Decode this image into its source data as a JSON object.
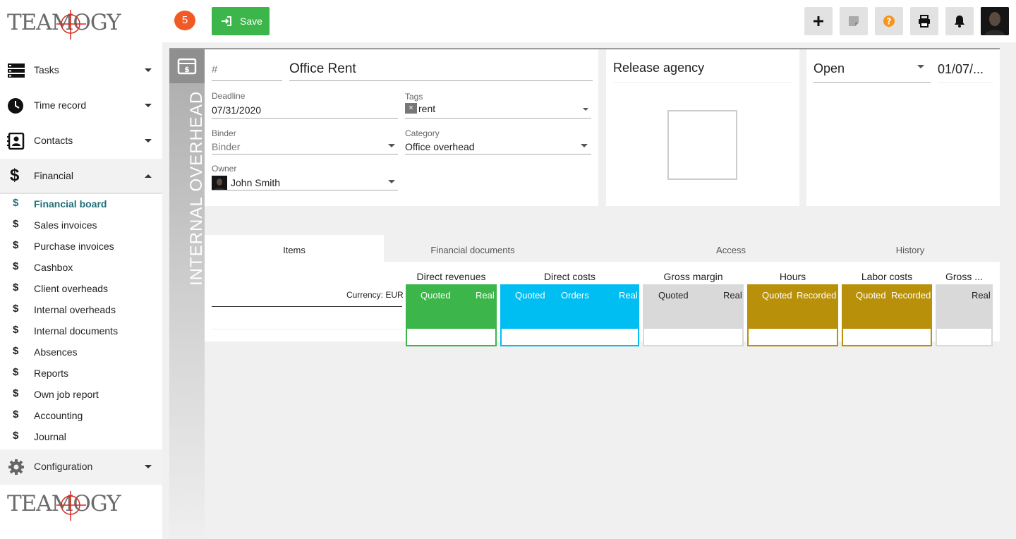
{
  "brand": {
    "logo_text": "TEAMOGY"
  },
  "sidebar": {
    "items": [
      {
        "label": "Tasks"
      },
      {
        "label": "Time record"
      },
      {
        "label": "Contacts"
      },
      {
        "label": "Financial"
      }
    ],
    "financial_sub": [
      {
        "label": "Financial board"
      },
      {
        "label": "Sales invoices"
      },
      {
        "label": "Purchase invoices"
      },
      {
        "label": "Cashbox"
      },
      {
        "label": "Client overheads"
      },
      {
        "label": "Internal overheads"
      },
      {
        "label": "Internal documents"
      },
      {
        "label": "Absences"
      },
      {
        "label": "Reports"
      },
      {
        "label": "Own job report"
      },
      {
        "label": "Accounting"
      },
      {
        "label": "Journal"
      }
    ],
    "config_label": "Configuration"
  },
  "toolbar": {
    "notification_count": "5",
    "save_label": "Save"
  },
  "record": {
    "type_label": "INTERNAL OVERHEAD",
    "number_placeholder": "#",
    "title": "Office Rent",
    "deadline_label": "Deadline",
    "deadline": "07/31/2020",
    "tags_label": "Tags",
    "tag": "rent",
    "tag_remove": "×",
    "binder_label": "Binder",
    "binder_placeholder": "Binder",
    "category_label": "Category",
    "category": "Office overhead",
    "owner_label": "Owner",
    "owner": "John Smith",
    "agency_title": "Release agency",
    "status": "Open",
    "date": "01/07/..."
  },
  "tabs": [
    {
      "label": "Items"
    },
    {
      "label": "Financial documents"
    },
    {
      "label": "Access"
    },
    {
      "label": "History"
    }
  ],
  "table": {
    "currency_label": "Currency: EUR",
    "groups": [
      {
        "title": "Direct revenues",
        "subs": [
          "Quoted",
          "Real"
        ],
        "color": "#3cb54a"
      },
      {
        "title": "Direct costs",
        "subs": [
          "Quoted",
          "Orders",
          "Real"
        ],
        "color": "#00bdf2"
      },
      {
        "title": "Gross margin",
        "subs": [
          "Quoted",
          "Real"
        ],
        "color": "#d9d9d9"
      },
      {
        "title": "Hours",
        "subs": [
          "Quoted",
          "Recorded"
        ],
        "color": "#b8900a"
      },
      {
        "title": "Labor costs",
        "subs": [
          "Quoted",
          "Recorded"
        ],
        "color": "#b8900a"
      },
      {
        "title": "Gross ...",
        "subs": [
          "Real"
        ],
        "color": "#d9d9d9"
      }
    ]
  }
}
